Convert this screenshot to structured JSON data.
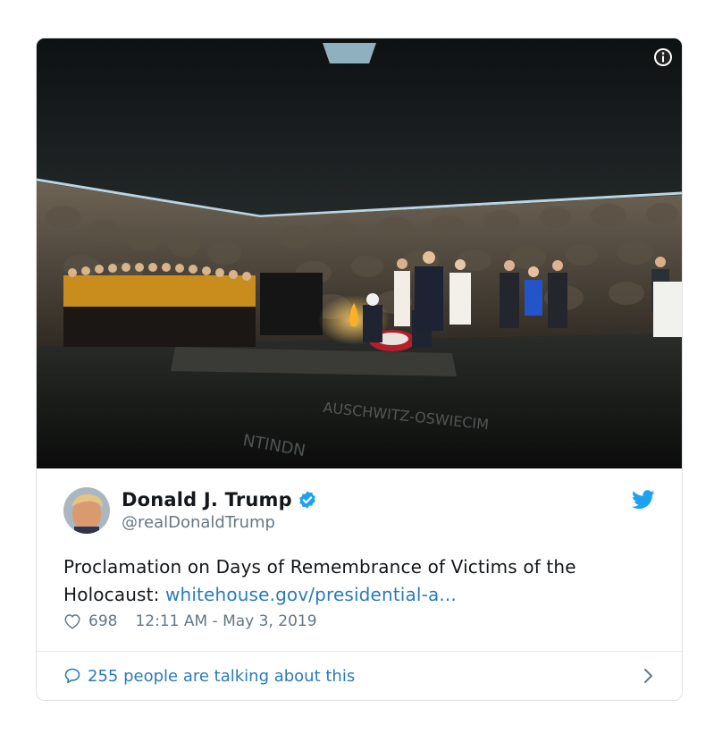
{
  "tweet": {
    "author_name": "Donald J. Trump",
    "author_handle": "@realDonaldTrump",
    "text_prefix": "Proclamation on Days of Remembrance of Victims of the Holocaust: ",
    "link_text": "whitehouse.gov/presidential-a...",
    "likes": "698",
    "timestamp": "12:11 AM - May 3, 2019",
    "talk_text": "255 people are talking about this"
  },
  "colors": {
    "link": "#2b7bb9",
    "verified": "#1da1f2",
    "text": "#14171a",
    "muted": "#657786",
    "border": "#dfe3e6"
  },
  "icons": [
    "info-icon",
    "verified-badge-icon",
    "twitter-bird-icon",
    "heart-icon",
    "speech-bubble-icon",
    "chevron-right-icon"
  ]
}
